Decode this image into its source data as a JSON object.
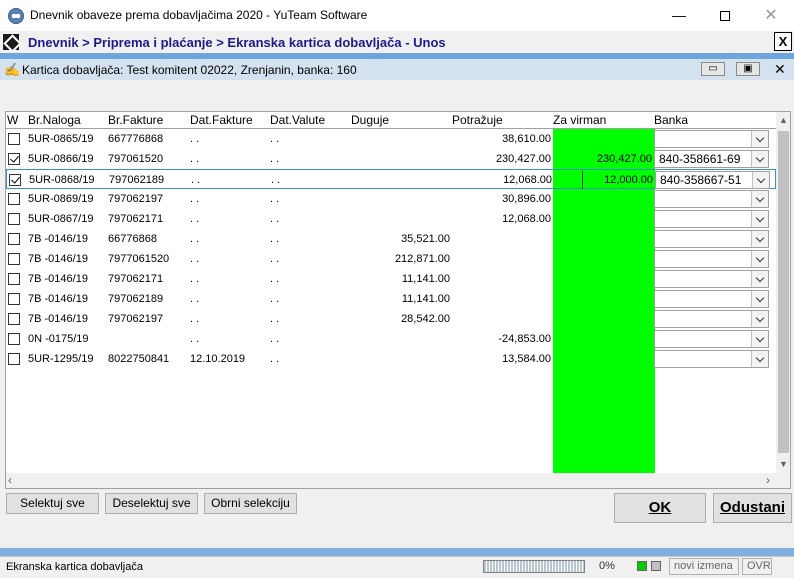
{
  "window": {
    "title": "Dnevnik obaveze prema dobavljačima 2020 - YuTeam Software",
    "minimize": "—",
    "close": "✕"
  },
  "breadcrumb": {
    "text": "Dnevnik > Priprema i plaćanje > Ekranska kartica dobavljača - Unos",
    "close": "X"
  },
  "child_window": {
    "title": "Kartica dobavljača: Test komitent 02022, Zrenjanin, banka: 160",
    "icon": "signature-icon",
    "close": "✕"
  },
  "table": {
    "headers": {
      "w": "W",
      "br_naloga": "Br.Naloga",
      "br_fakture": "Br.Fakture",
      "dat_fakture": "Dat.Fakture",
      "dat_valute": "Dat.Valute",
      "duguje": "Duguje",
      "potrazuje": "Potražuje",
      "za_virman": "Za virman",
      "banka": "Banka"
    },
    "rows": [
      {
        "checked": false,
        "br_naloga": "5UR-0865/19",
        "br_fakture": "667776868",
        "dat_fakture": ". .",
        "dat_valute": ". .",
        "duguje": "",
        "potrazuje": "38,610.00",
        "za_virman": "",
        "banka": ""
      },
      {
        "checked": true,
        "br_naloga": "5UR-0866/19",
        "br_fakture": "797061520",
        "dat_fakture": ". .",
        "dat_valute": ". .",
        "duguje": "",
        "potrazuje": "230,427.00",
        "za_virman": "230,427.00",
        "banka": "840-358661-69"
      },
      {
        "checked": true,
        "br_naloga": "5UR-0868/19",
        "br_fakture": "797062189",
        "dat_fakture": ". .",
        "dat_valute": ". .",
        "duguje": "",
        "potrazuje": "12,068.00",
        "za_virman": "12,000.00",
        "banka": "840-358667-51"
      },
      {
        "checked": false,
        "br_naloga": "5UR-0869/19",
        "br_fakture": "797062197",
        "dat_fakture": ". .",
        "dat_valute": ". .",
        "duguje": "",
        "potrazuje": "30,896.00",
        "za_virman": "",
        "banka": ""
      },
      {
        "checked": false,
        "br_naloga": "5UR-0867/19",
        "br_fakture": "797062171",
        "dat_fakture": ". .",
        "dat_valute": ". .",
        "duguje": "",
        "potrazuje": "12,068.00",
        "za_virman": "",
        "banka": ""
      },
      {
        "checked": false,
        "br_naloga": "7B -0146/19",
        "br_fakture": "66776868",
        "dat_fakture": ". .",
        "dat_valute": ". .",
        "duguje": "35,521.00",
        "potrazuje": "",
        "za_virman": "",
        "banka": ""
      },
      {
        "checked": false,
        "br_naloga": "7B -0146/19",
        "br_fakture": "7977061520",
        "dat_fakture": ". .",
        "dat_valute": ". .",
        "duguje": "212,871.00",
        "potrazuje": "",
        "za_virman": "",
        "banka": ""
      },
      {
        "checked": false,
        "br_naloga": "7B -0146/19",
        "br_fakture": "797062171",
        "dat_fakture": ". .",
        "dat_valute": ". .",
        "duguje": "11,141.00",
        "potrazuje": "",
        "za_virman": "",
        "banka": ""
      },
      {
        "checked": false,
        "br_naloga": "7B -0146/19",
        "br_fakture": "797062189",
        "dat_fakture": ". .",
        "dat_valute": ". .",
        "duguje": "11,141.00",
        "potrazuje": "",
        "za_virman": "",
        "banka": ""
      },
      {
        "checked": false,
        "br_naloga": "7B -0146/19",
        "br_fakture": "797062197",
        "dat_fakture": ". .",
        "dat_valute": ". .",
        "duguje": "28,542.00",
        "potrazuje": "",
        "za_virman": "",
        "banka": ""
      },
      {
        "checked": false,
        "br_naloga": "0N -0175/19",
        "br_fakture": "",
        "dat_fakture": ". .",
        "dat_valute": ". .",
        "duguje": "",
        "potrazuje": "-24,853.00",
        "za_virman": "",
        "banka": ""
      },
      {
        "checked": false,
        "br_naloga": "5UR-1295/19",
        "br_fakture": "8022750841",
        "dat_fakture": "12.10.2019",
        "dat_valute": ". .",
        "duguje": "",
        "potrazuje": "13,584.00",
        "za_virman": "",
        "banka": ""
      }
    ]
  },
  "buttons": {
    "select_all": "Selektuj sve",
    "deselect_all": "Deselektuj sve",
    "invert": "Obrni selekciju",
    "ok": "OK",
    "cancel": "Odustani"
  },
  "status": {
    "text": "Ekranska kartica dobavljača",
    "progress_percent": 0,
    "percent_label": "0%",
    "changes": "novi izmena",
    "mode": "OVR"
  },
  "colors": {
    "virman_column": "#00ff00",
    "breadcrumb_text": "#1b1b8a",
    "selected_row_border": "#3d8fc7"
  }
}
